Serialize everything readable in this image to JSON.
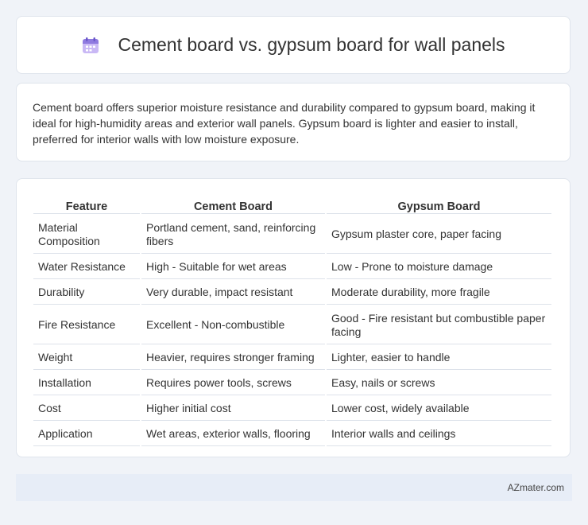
{
  "header": {
    "icon": "calendar-icon",
    "title": "Cement board vs. gypsum board for wall panels"
  },
  "summary": {
    "text": "Cement board offers superior moisture resistance and durability compared to gypsum board, making it ideal for high-humidity areas and exterior wall panels. Gypsum board is lighter and easier to install, preferred for interior walls with low moisture exposure."
  },
  "table": {
    "headers": [
      "Feature",
      "Cement Board",
      "Gypsum Board"
    ],
    "rows": [
      [
        "Material Composition",
        "Portland cement, sand, reinforcing fibers",
        "Gypsum plaster core, paper facing"
      ],
      [
        "Water Resistance",
        "High - Suitable for wet areas",
        "Low - Prone to moisture damage"
      ],
      [
        "Durability",
        "Very durable, impact resistant",
        "Moderate durability, more fragile"
      ],
      [
        "Fire Resistance",
        "Excellent - Non-combustible",
        "Good - Fire resistant but combustible paper facing"
      ],
      [
        "Weight",
        "Heavier, requires stronger framing",
        "Lighter, easier to handle"
      ],
      [
        "Installation",
        "Requires power tools, screws",
        "Easy, nails or screws"
      ],
      [
        "Cost",
        "Higher initial cost",
        "Lower cost, widely available"
      ],
      [
        "Application",
        "Wet areas, exterior walls, flooring",
        "Interior walls and ceilings"
      ]
    ]
  },
  "footer": {
    "brand": "AZmater.com"
  },
  "colors": {
    "background": "#f0f3f8",
    "card": "#ffffff",
    "footer": "#e7edf7",
    "icon_accent": "#9a7fe0"
  }
}
